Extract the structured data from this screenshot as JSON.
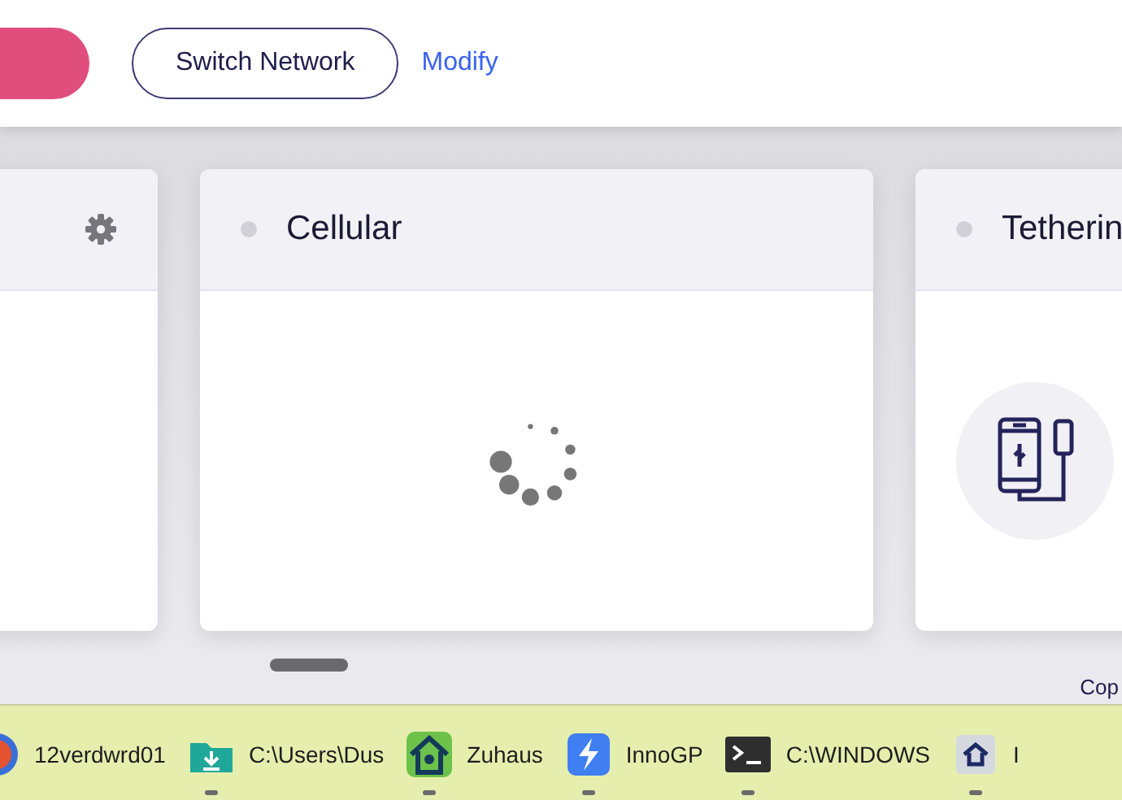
{
  "toolbar": {
    "buttons": [
      {
        "kind": "primary"
      },
      {
        "kind": "outline",
        "label": "Switch Network"
      },
      {
        "kind": "link",
        "label": "Modify"
      }
    ]
  },
  "cards": [
    {
      "kind": "blank",
      "gear": true
    },
    {
      "title": "Cellular",
      "kind": "loading",
      "gear": false
    },
    {
      "title": "Tetherin",
      "kind": "tethering",
      "gear": false
    }
  ],
  "footer": {
    "text": "Cop"
  },
  "taskbar": [
    {
      "label": "12verdwrd01",
      "running": false
    },
    {
      "label": "C:\\Users\\Dus",
      "running": true
    },
    {
      "label": "Zuhaus",
      "running": true
    },
    {
      "label": "InnoGP",
      "running": true
    },
    {
      "label": "C:\\WINDOWS",
      "running": true
    },
    {
      "label": "I",
      "running": true
    }
  ]
}
